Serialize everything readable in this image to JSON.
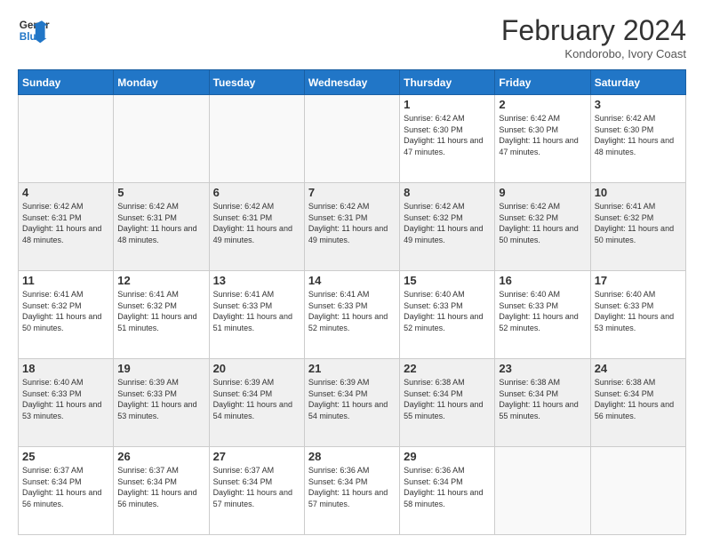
{
  "header": {
    "logo_line1": "General",
    "logo_line2": "Blue",
    "month_title": "February 2024",
    "subtitle": "Kondorobo, Ivory Coast"
  },
  "weekdays": [
    "Sunday",
    "Monday",
    "Tuesday",
    "Wednesday",
    "Thursday",
    "Friday",
    "Saturday"
  ],
  "weeks": [
    [
      {
        "day": "",
        "info": ""
      },
      {
        "day": "",
        "info": ""
      },
      {
        "day": "",
        "info": ""
      },
      {
        "day": "",
        "info": ""
      },
      {
        "day": "1",
        "info": "Sunrise: 6:42 AM\nSunset: 6:30 PM\nDaylight: 11 hours\nand 47 minutes."
      },
      {
        "day": "2",
        "info": "Sunrise: 6:42 AM\nSunset: 6:30 PM\nDaylight: 11 hours\nand 47 minutes."
      },
      {
        "day": "3",
        "info": "Sunrise: 6:42 AM\nSunset: 6:30 PM\nDaylight: 11 hours\nand 48 minutes."
      }
    ],
    [
      {
        "day": "4",
        "info": "Sunrise: 6:42 AM\nSunset: 6:31 PM\nDaylight: 11 hours\nand 48 minutes."
      },
      {
        "day": "5",
        "info": "Sunrise: 6:42 AM\nSunset: 6:31 PM\nDaylight: 11 hours\nand 48 minutes."
      },
      {
        "day": "6",
        "info": "Sunrise: 6:42 AM\nSunset: 6:31 PM\nDaylight: 11 hours\nand 49 minutes."
      },
      {
        "day": "7",
        "info": "Sunrise: 6:42 AM\nSunset: 6:31 PM\nDaylight: 11 hours\nand 49 minutes."
      },
      {
        "day": "8",
        "info": "Sunrise: 6:42 AM\nSunset: 6:32 PM\nDaylight: 11 hours\nand 49 minutes."
      },
      {
        "day": "9",
        "info": "Sunrise: 6:42 AM\nSunset: 6:32 PM\nDaylight: 11 hours\nand 50 minutes."
      },
      {
        "day": "10",
        "info": "Sunrise: 6:41 AM\nSunset: 6:32 PM\nDaylight: 11 hours\nand 50 minutes."
      }
    ],
    [
      {
        "day": "11",
        "info": "Sunrise: 6:41 AM\nSunset: 6:32 PM\nDaylight: 11 hours\nand 50 minutes."
      },
      {
        "day": "12",
        "info": "Sunrise: 6:41 AM\nSunset: 6:32 PM\nDaylight: 11 hours\nand 51 minutes."
      },
      {
        "day": "13",
        "info": "Sunrise: 6:41 AM\nSunset: 6:33 PM\nDaylight: 11 hours\nand 51 minutes."
      },
      {
        "day": "14",
        "info": "Sunrise: 6:41 AM\nSunset: 6:33 PM\nDaylight: 11 hours\nand 52 minutes."
      },
      {
        "day": "15",
        "info": "Sunrise: 6:40 AM\nSunset: 6:33 PM\nDaylight: 11 hours\nand 52 minutes."
      },
      {
        "day": "16",
        "info": "Sunrise: 6:40 AM\nSunset: 6:33 PM\nDaylight: 11 hours\nand 52 minutes."
      },
      {
        "day": "17",
        "info": "Sunrise: 6:40 AM\nSunset: 6:33 PM\nDaylight: 11 hours\nand 53 minutes."
      }
    ],
    [
      {
        "day": "18",
        "info": "Sunrise: 6:40 AM\nSunset: 6:33 PM\nDaylight: 11 hours\nand 53 minutes."
      },
      {
        "day": "19",
        "info": "Sunrise: 6:39 AM\nSunset: 6:33 PM\nDaylight: 11 hours\nand 53 minutes."
      },
      {
        "day": "20",
        "info": "Sunrise: 6:39 AM\nSunset: 6:34 PM\nDaylight: 11 hours\nand 54 minutes."
      },
      {
        "day": "21",
        "info": "Sunrise: 6:39 AM\nSunset: 6:34 PM\nDaylight: 11 hours\nand 54 minutes."
      },
      {
        "day": "22",
        "info": "Sunrise: 6:38 AM\nSunset: 6:34 PM\nDaylight: 11 hours\nand 55 minutes."
      },
      {
        "day": "23",
        "info": "Sunrise: 6:38 AM\nSunset: 6:34 PM\nDaylight: 11 hours\nand 55 minutes."
      },
      {
        "day": "24",
        "info": "Sunrise: 6:38 AM\nSunset: 6:34 PM\nDaylight: 11 hours\nand 56 minutes."
      }
    ],
    [
      {
        "day": "25",
        "info": "Sunrise: 6:37 AM\nSunset: 6:34 PM\nDaylight: 11 hours\nand 56 minutes."
      },
      {
        "day": "26",
        "info": "Sunrise: 6:37 AM\nSunset: 6:34 PM\nDaylight: 11 hours\nand 56 minutes."
      },
      {
        "day": "27",
        "info": "Sunrise: 6:37 AM\nSunset: 6:34 PM\nDaylight: 11 hours\nand 57 minutes."
      },
      {
        "day": "28",
        "info": "Sunrise: 6:36 AM\nSunset: 6:34 PM\nDaylight: 11 hours\nand 57 minutes."
      },
      {
        "day": "29",
        "info": "Sunrise: 6:36 AM\nSunset: 6:34 PM\nDaylight: 11 hours\nand 58 minutes."
      },
      {
        "day": "",
        "info": ""
      },
      {
        "day": "",
        "info": ""
      }
    ]
  ]
}
